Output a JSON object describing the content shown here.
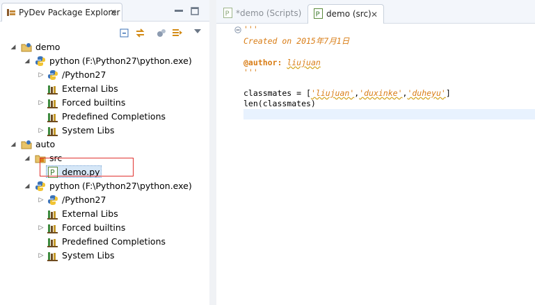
{
  "explorer": {
    "title": "PyDev Package Explorer",
    "tree": [
      {
        "label": "demo",
        "path": ""
      },
      {
        "label": "python",
        "path": "(F:\\Python27\\python.exe)"
      },
      {
        "label": "/Python27",
        "path": ""
      },
      {
        "label": "External Libs",
        "path": ""
      },
      {
        "label": "Forced builtins",
        "path": ""
      },
      {
        "label": "Predefined Completions",
        "path": ""
      },
      {
        "label": "System Libs",
        "path": ""
      },
      {
        "label": "auto",
        "path": ""
      },
      {
        "label": "src",
        "path": ""
      },
      {
        "label": "demo.py",
        "path": ""
      },
      {
        "label": "python",
        "path": "(F:\\Python27\\python.exe)"
      },
      {
        "label": "/Python27",
        "path": ""
      },
      {
        "label": "External Libs",
        "path": ""
      },
      {
        "label": "Forced builtins",
        "path": ""
      },
      {
        "label": "Predefined Completions",
        "path": ""
      },
      {
        "label": "System Libs",
        "path": ""
      }
    ]
  },
  "editor": {
    "tabs": [
      {
        "label": "*demo (Scripts)"
      },
      {
        "label": "demo (src)"
      }
    ],
    "code": {
      "doc_open": "'''",
      "created": "Created on 2015年7月1日",
      "author_tag": "@author:",
      "author_name": "liujuan",
      "doc_close": "'''",
      "line_list_prefix": "classmates = [",
      "str1": "'liujuan'",
      "comma1": ",",
      "str2": "'duxinke'",
      "comma2": ",",
      "str3": "'duheyu'",
      "line_list_suffix": "]",
      "line_len": "len(classmates)"
    }
  },
  "colors": {
    "docstring": "#d97d16",
    "selection_border": "#e0322f"
  }
}
